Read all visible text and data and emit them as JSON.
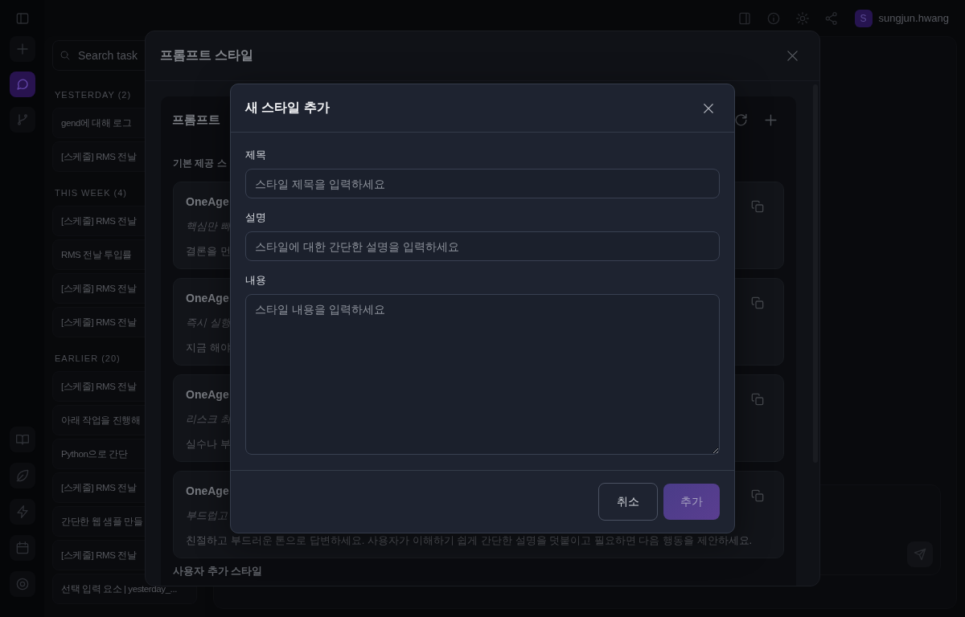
{
  "topbar": {
    "user": {
      "initial": "S",
      "name": "sungjun.hwang"
    }
  },
  "rail": {
    "items": [
      {
        "selected": false
      },
      {
        "selected": true
      },
      {
        "selected": false
      }
    ]
  },
  "sidebar": {
    "search": {
      "placeholder": "Search task"
    },
    "groups": [
      {
        "title": "YESTERDAY (2)",
        "items": [
          "gend에 대해 로그",
          "[스케줄] RMS 전날"
        ]
      },
      {
        "title": "THIS WEEK (4)",
        "items": [
          "[스케줄] RMS 전날",
          "RMS 전날 투입률",
          "[스케줄] RMS 전날",
          "[스케줄] RMS 전날"
        ]
      },
      {
        "title": "EARLIER (20)",
        "items": [
          "[스케줄] RMS 전날",
          "아래 작업을 진행해",
          "Python으로 간단",
          "[스케줄] RMS 전날",
          "간단한 웹 샘플 만들",
          "[스케줄] RMS 전날",
          "선택 입력 요소 | yesterday_..."
        ]
      }
    ]
  },
  "styles_dialog": {
    "title": "프롬프트 스타일",
    "panel_title": "프롬프트",
    "section_title": "기본 제공 스",
    "styles": [
      {
        "name": "OneAge",
        "tagline": "핵심만 빠",
        "description": "결론을 먼"
      },
      {
        "name": "OneAge",
        "tagline": "즉시 실행",
        "description": "지금 해야"
      },
      {
        "name": "OneAge",
        "tagline": "리스크 최",
        "description": "실수나 부"
      },
      {
        "name": "OneAge",
        "tagline": "부드럽고",
        "description": "친절하고 부드러운 톤으로 답변하세요. 사용자가 이해하기 쉽게 간단한 설명을 덧붙이고 필요하면 다음 행동을 제안하세요."
      }
    ],
    "custom_section_title": "사용자 추가 스타일"
  },
  "add_style_dialog": {
    "title": "새 스타일 추가",
    "fields": [
      {
        "kind": "input",
        "label": "제목",
        "placeholder": "스타일 제목을 입력하세요"
      },
      {
        "kind": "input",
        "label": "설명",
        "placeholder": "스타일에 대한 간단한 설명을 입력하세요"
      },
      {
        "kind": "textarea",
        "label": "내용",
        "placeholder": "스타일 내용을 입력하세요"
      }
    ],
    "buttons": [
      {
        "kind": "secondary",
        "label": "취소",
        "disabled": false
      },
      {
        "kind": "primary",
        "label": "추가",
        "disabled": true
      }
    ]
  }
}
